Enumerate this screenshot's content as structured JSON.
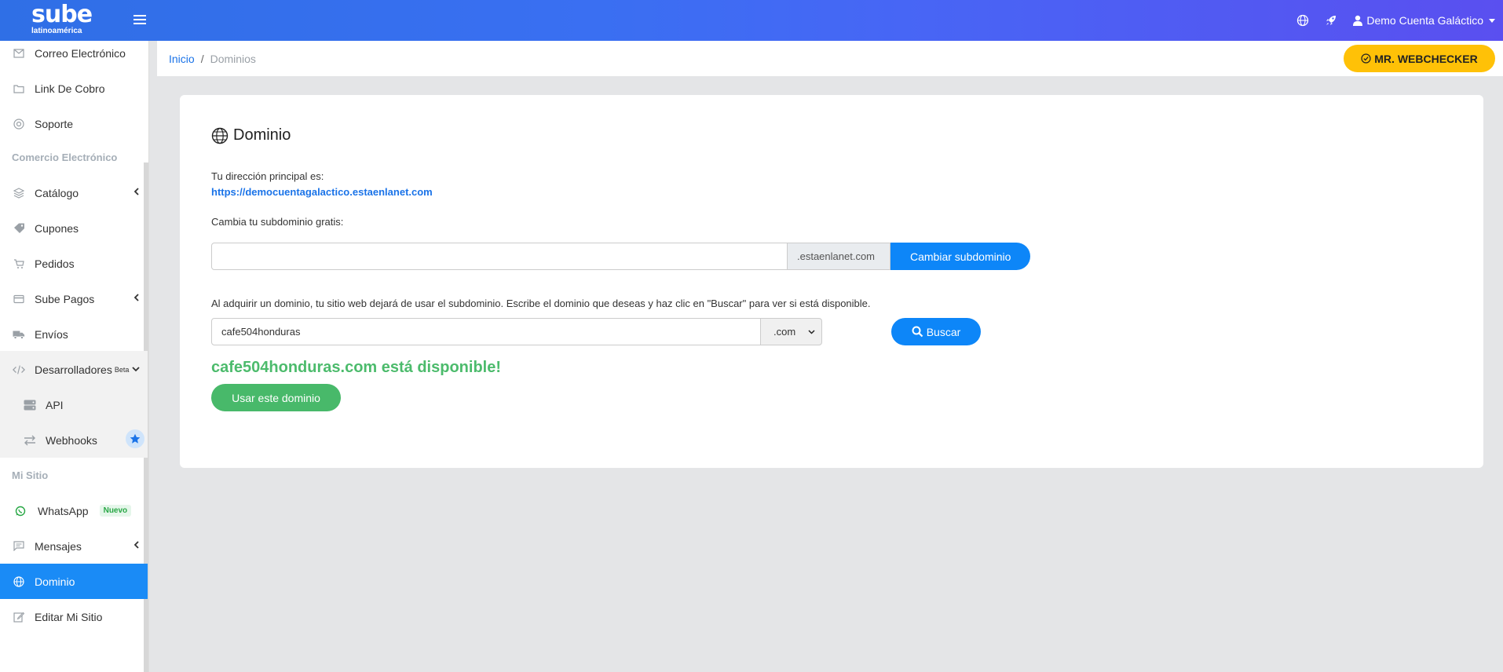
{
  "app": {
    "logo_text": "sube",
    "logo_subtext": "latinoamérica"
  },
  "topbar": {
    "user_name": "Demo Cuenta Galáctico",
    "icons": [
      "hamburger-icon",
      "globe-icon",
      "rocket-icon",
      "user-icon"
    ]
  },
  "sidebar": {
    "items_top": [
      {
        "label": "Correo Electrónico",
        "icon": "envelope-icon"
      },
      {
        "label": "Link De Cobro",
        "icon": "folder-icon"
      },
      {
        "label": "Soporte",
        "icon": "lifebuoy-icon"
      }
    ],
    "section_ecommerce": "Comercio Electrónico",
    "items_ecommerce": [
      {
        "label": "Catálogo",
        "icon": "layers-icon"
      },
      {
        "label": "Cupones",
        "icon": "ticket-icon"
      },
      {
        "label": "Pedidos",
        "icon": "cart-icon"
      },
      {
        "label": "Sube Pagos",
        "icon": "credit-card-icon"
      },
      {
        "label": "Envíos",
        "icon": "truck-icon"
      },
      {
        "label": "Desarrolladores",
        "icon": "code-icon",
        "sup": "Beta"
      }
    ],
    "sub_dev": [
      {
        "label": "API",
        "icon": "server-icon"
      },
      {
        "label": "Webhooks",
        "icon": "exchange-icon"
      }
    ],
    "section_site": "Mi Sitio",
    "items_site": [
      {
        "label": "WhatsApp",
        "icon": "whatsapp-icon",
        "badge": "Nuevo"
      },
      {
        "label": "Mensajes",
        "icon": "message-icon"
      },
      {
        "label": "Dominio",
        "icon": "globe-icon"
      },
      {
        "label": "Editar Mi Sitio",
        "icon": "edit-icon"
      }
    ]
  },
  "breadcrumb": {
    "home": "Inicio",
    "separator": "/",
    "current": "Dominios"
  },
  "header_button": {
    "label": "MR. WEBCHECKER"
  },
  "domain_card": {
    "title": "Dominio",
    "main_address_label": "Tu dirección principal es:",
    "main_address_url": "https://democuentagalactico.estaenlanet.com",
    "subdomain_label": "Cambia tu subdominio gratis:",
    "subdomain_value": "",
    "subdomain_suffix": ".estaenlanet.com",
    "subdomain_button": "Cambiar subdominio",
    "domain_help": "Al adquirir un dominio, tu sitio web dejará de usar el subdominio. Escribe el dominio que deseas y haz clic en \"Buscar\" para ver si está disponible.",
    "domain_value": "cafe504honduras",
    "tld_selected": ".com",
    "search_button": "Buscar",
    "availability_message": "cafe504honduras.com está disponible!",
    "use_domain_button": "Usar este dominio"
  },
  "colors": {
    "primary": "#0d86f8",
    "success": "#48b96a",
    "warning": "#ffc107",
    "topbar_start": "#2f6fe6",
    "topbar_end": "#5a4ff0"
  }
}
